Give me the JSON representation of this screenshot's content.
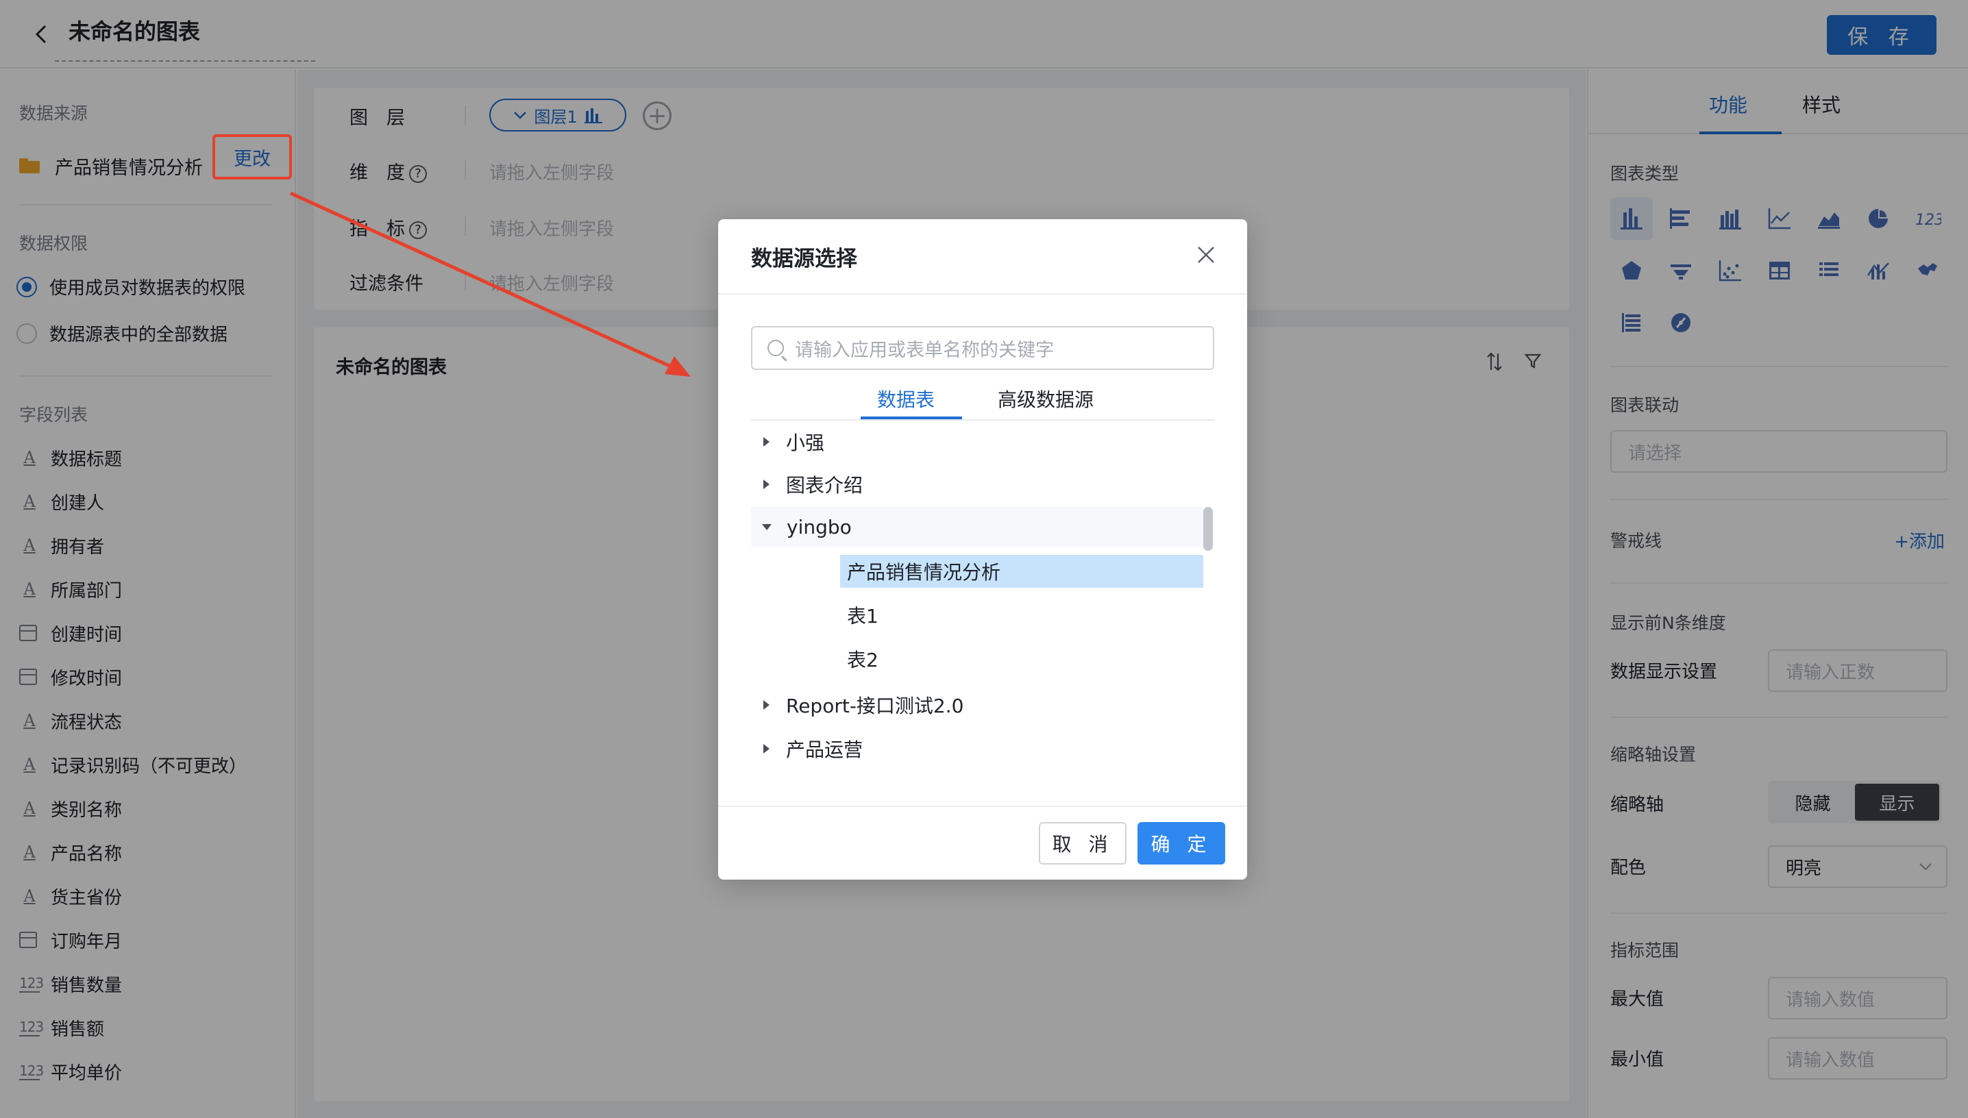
{
  "header": {
    "title": "未命名的图表",
    "save_label": "保 存"
  },
  "left": {
    "data_source_title": "数据来源",
    "source_name": "产品销售情况分析",
    "change_label": "更改",
    "permission_title": "数据权限",
    "permission_options": [
      "使用成员对数据表的权限",
      "数据源表中的全部数据"
    ],
    "field_list_title": "字段列表",
    "fields": [
      {
        "type": "text",
        "name": "数据标题"
      },
      {
        "type": "text",
        "name": "创建人"
      },
      {
        "type": "text",
        "name": "拥有者"
      },
      {
        "type": "text",
        "name": "所属部门"
      },
      {
        "type": "date",
        "name": "创建时间"
      },
      {
        "type": "date",
        "name": "修改时间"
      },
      {
        "type": "text",
        "name": "流程状态"
      },
      {
        "type": "text",
        "name": "记录识别码（不可更改）"
      },
      {
        "type": "text",
        "name": "类别名称"
      },
      {
        "type": "text",
        "name": "产品名称"
      },
      {
        "type": "text",
        "name": "货主省份"
      },
      {
        "type": "date",
        "name": "订购年月"
      },
      {
        "type": "num",
        "name": "销售数量"
      },
      {
        "type": "num",
        "name": "销售额"
      },
      {
        "type": "num",
        "name": "平均单价"
      }
    ],
    "text_icon_glyph": "A",
    "num_icon_glyph": "123"
  },
  "center": {
    "layer_label": "图　层",
    "layer_pill": "图层1",
    "dimension_label": "维　度",
    "metric_label": "指　标",
    "filter_label": "过滤条件",
    "drag_placeholder": "请拖入左侧字段",
    "chart_title": "未命名的图表"
  },
  "right": {
    "tabs": [
      "功能",
      "样式"
    ],
    "chart_type_title": "图表类型",
    "chart_link_title": "图表联动",
    "chart_link_placeholder": "请选择",
    "warning_line_title": "警戒线",
    "add_label": "+添加",
    "top_n_title": "显示前N条维度",
    "display_setting_label": "数据显示设置",
    "display_setting_placeholder": "请输入正数",
    "thumb_axis_title": "缩略轴设置",
    "thumb_axis_label": "缩略轴",
    "thumb_hide": "隐藏",
    "thumb_show": "显示",
    "color_label": "配色",
    "color_value": "明亮",
    "metric_range_title": "指标范围",
    "max_label": "最大值",
    "min_label": "最小值",
    "number_placeholder": "请输入数值"
  },
  "modal": {
    "title": "数据源选择",
    "search_placeholder": "请输入应用或表单名称的关键字",
    "tabs": [
      "数据表",
      "高级数据源"
    ],
    "tree": [
      {
        "label": "小强",
        "expanded": false
      },
      {
        "label": "图表介绍",
        "expanded": false
      },
      {
        "label": "yingbo",
        "expanded": true,
        "children": [
          "产品销售情况分析",
          "表1",
          "表2"
        ],
        "selected": "产品销售情况分析"
      },
      {
        "label": "Report-接口测试2.0",
        "expanded": false
      },
      {
        "label": "产品运营",
        "expanded": false
      }
    ],
    "cancel_label": "取 消",
    "ok_label": "确 定"
  },
  "colors": {
    "primary": "#1f6fd1",
    "confirm_button": "#2f88f0",
    "annotation_red": "#e5412c",
    "selected_row": "#c7e3fb"
  }
}
